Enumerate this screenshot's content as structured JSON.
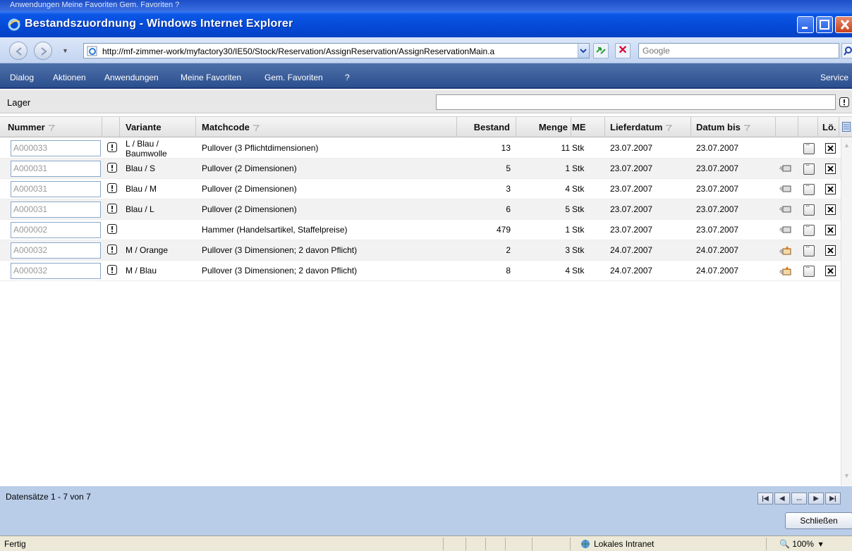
{
  "window": {
    "top_strip": "Anwendungen   Meine Favoriten   Gem. Favoriten   ?",
    "title": "Bestandszuordnung - Windows Internet Explorer"
  },
  "address": {
    "url": "http://mf-zimmer-work/myfactory30/IE50/Stock/Reservation/AssignReservation/AssignReservationMain.a",
    "search_placeholder": "Google"
  },
  "menu": {
    "items": [
      "Dialog",
      "Aktionen",
      "Anwendungen",
      "Meine Favoriten",
      "Gem. Favoriten",
      "?"
    ],
    "right": "Service"
  },
  "lager": {
    "label": "Lager",
    "value": ""
  },
  "grid": {
    "columns": {
      "nummer": "Nummer",
      "variante": "Variante",
      "matchcode": "Matchcode",
      "bestand": "Bestand",
      "menge": "Menge",
      "me": "ME",
      "lieferdatum": "Lieferdatum",
      "datum_bis": "Datum bis",
      "loeschen": "Lö."
    },
    "rows": [
      {
        "nummer": "A000033",
        "variante": "L / Blau /",
        "variante2": "Baumwolle",
        "matchcode": "Pullover (3 Pflichtdimensionen)",
        "bestand": "13",
        "menge": "11",
        "me": "Stk",
        "lieferdatum": "23.07.2007",
        "datum_bis": "23.07.2007",
        "icon": "none"
      },
      {
        "nummer": "A000031",
        "variante": "Blau / S",
        "variante2": "",
        "matchcode": "Pullover (2 Dimensionen)",
        "bestand": "5",
        "menge": "1",
        "me": "Stk",
        "lieferdatum": "23.07.2007",
        "datum_bis": "23.07.2007",
        "icon": "truck"
      },
      {
        "nummer": "A000031",
        "variante": "Blau / M",
        "variante2": "",
        "matchcode": "Pullover (2 Dimensionen)",
        "bestand": "3",
        "menge": "4",
        "me": "Stk",
        "lieferdatum": "23.07.2007",
        "datum_bis": "23.07.2007",
        "icon": "truck"
      },
      {
        "nummer": "A000031",
        "variante": "Blau / L",
        "variante2": "",
        "matchcode": "Pullover (2 Dimensionen)",
        "bestand": "6",
        "menge": "5",
        "me": "Stk",
        "lieferdatum": "23.07.2007",
        "datum_bis": "23.07.2007",
        "icon": "truck"
      },
      {
        "nummer": "A000002",
        "variante": "",
        "variante2": "",
        "matchcode": "Hammer (Handelsartikel, Staffelpreise)",
        "bestand": "479",
        "menge": "1",
        "me": "Stk",
        "lieferdatum": "23.07.2007",
        "datum_bis": "23.07.2007",
        "icon": "truck"
      },
      {
        "nummer": "A000032",
        "variante": "M / Orange",
        "variante2": "",
        "matchcode": "Pullover (3 Dimensionen; 2 davon Pflicht)",
        "bestand": "2",
        "menge": "3",
        "me": "Stk",
        "lieferdatum": "24.07.2007",
        "datum_bis": "24.07.2007",
        "icon": "truck-warn"
      },
      {
        "nummer": "A000032",
        "variante": "M / Blau",
        "variante2": "",
        "matchcode": "Pullover (3 Dimensionen; 2 davon Pflicht)",
        "bestand": "8",
        "menge": "4",
        "me": "Stk",
        "lieferdatum": "24.07.2007",
        "datum_bis": "24.07.2007",
        "icon": "truck-warn"
      }
    ]
  },
  "footer": {
    "record_count": "Datensätze 1 - 7 von 7",
    "pager": [
      "first",
      "prev",
      "...",
      "next",
      "last"
    ],
    "close_button": "Schließen"
  },
  "status": {
    "text": "Fertig",
    "zone": "Lokales Intranet",
    "zoom": "100%"
  },
  "colors": {
    "titlebar": "#0549d6",
    "menubar": "#2c4f8f",
    "footer": "#b9cde9"
  }
}
